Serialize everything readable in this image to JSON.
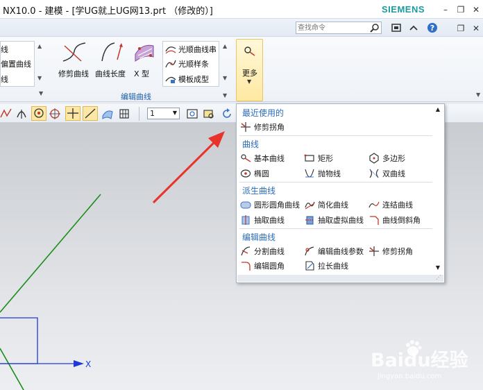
{
  "window": {
    "title": "NX10.0 - 建模 - [学UG就上UG网13.prt （修改的）]",
    "brand": "SIEMENS",
    "controls": [
      "–",
      "❐",
      "✕"
    ]
  },
  "search": {
    "placeholder": "查找命令"
  },
  "ribbon": {
    "left_list": [
      "线",
      "偏置曲线",
      "线"
    ],
    "buttons": {
      "trim_curve": "修剪曲线",
      "curve_length": "曲线长度",
      "x_type": "X 型"
    },
    "right_list": [
      "光顺曲线串",
      "光顺样条",
      "模板成型"
    ],
    "group_edit_curve": "编辑曲线",
    "more_label": "更多"
  },
  "toolbar": {
    "zoom_value": "1"
  },
  "dropdown": {
    "sections": [
      {
        "title": "最近使用的",
        "items": [
          {
            "label": "修剪拐角",
            "icon": "trim-corner-icon"
          }
        ]
      },
      {
        "title": "曲线",
        "items": [
          {
            "label": "基本曲线",
            "icon": "basic-curve-icon"
          },
          {
            "label": "矩形",
            "icon": "rectangle-icon"
          },
          {
            "label": "多边形",
            "icon": "polygon-icon"
          },
          {
            "label": "椭圆",
            "icon": "ellipse-icon"
          },
          {
            "label": "抛物线",
            "icon": "parabola-icon"
          },
          {
            "label": "双曲线",
            "icon": "hyperbola-icon"
          }
        ]
      },
      {
        "title": "派生曲线",
        "items": [
          {
            "label": "圆形圆角曲线",
            "icon": "round-fillet-curve-icon"
          },
          {
            "label": "简化曲线",
            "icon": "simplify-curve-icon"
          },
          {
            "label": "连结曲线",
            "icon": "join-curve-icon"
          },
          {
            "label": "抽取曲线",
            "icon": "extract-curve-icon"
          },
          {
            "label": "抽取虚拟曲线",
            "icon": "extract-virtual-curve-icon"
          },
          {
            "label": "曲线倒斜角",
            "icon": "curve-chamfer-icon"
          }
        ]
      },
      {
        "title": "编辑曲线",
        "items": [
          {
            "label": "分割曲线",
            "icon": "divide-curve-icon"
          },
          {
            "label": "编辑曲线参数",
            "icon": "edit-curve-params-icon"
          },
          {
            "label": "修剪拐角",
            "icon": "trim-corner-icon"
          },
          {
            "label": "编辑圆角",
            "icon": "edit-fillet-icon"
          },
          {
            "label": "拉长曲线",
            "icon": "stretch-curve-icon"
          }
        ]
      }
    ]
  },
  "canvas": {
    "axis_label": "X"
  },
  "watermark": {
    "text": "Baidu经验",
    "url": "jingyan.baidu.com"
  },
  "colors": {
    "accent": "#2a6bb8",
    "brand": "#1b9aa0",
    "axis_line": "#1a8c1a",
    "axis_blue": "#1e3ad6"
  }
}
